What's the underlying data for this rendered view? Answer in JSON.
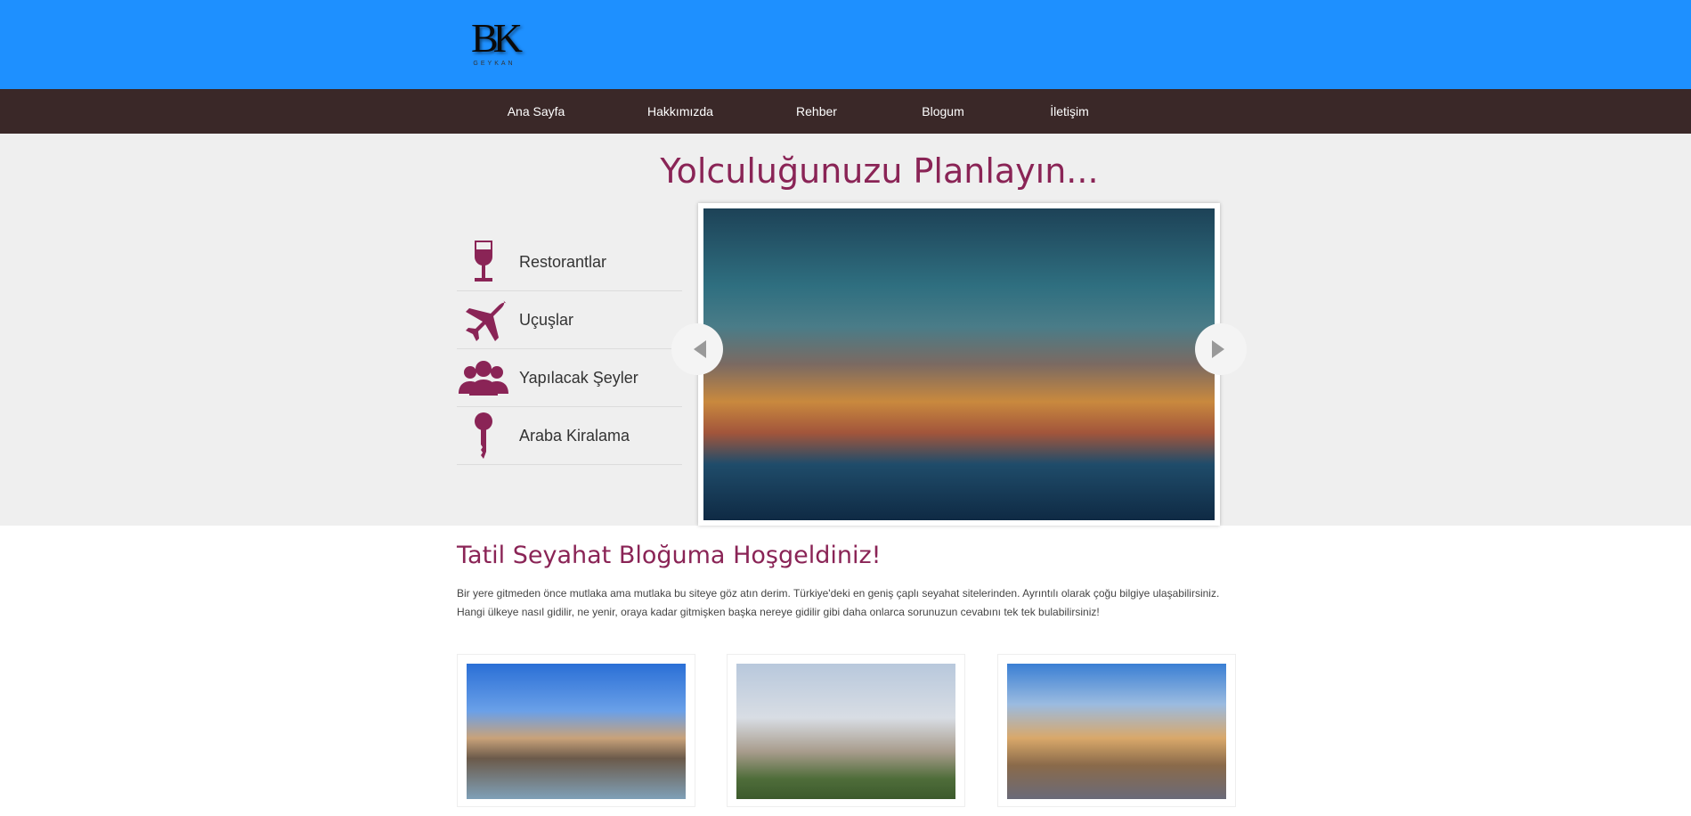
{
  "header": {
    "logo_text": "BK",
    "logo_sub": "GEYKAN",
    "bg": "#1e90ff"
  },
  "nav": {
    "items": [
      {
        "label": "Ana Sayfa"
      },
      {
        "label": "Hakkımızda"
      },
      {
        "label": "Rehber"
      },
      {
        "label": "Blogum"
      },
      {
        "label": "İletişim"
      }
    ]
  },
  "hero": {
    "title": "Yolculuğunuzu Planlayın...",
    "menu": [
      {
        "label": "Restorantlar",
        "icon": "wine-glass-icon"
      },
      {
        "label": "Uçuşlar",
        "icon": "airplane-icon"
      },
      {
        "label": "Yapılacak Şeyler",
        "icon": "people-icon"
      },
      {
        "label": "Araba Kiralama",
        "icon": "key-icon"
      }
    ],
    "accent": "#8a2456"
  },
  "main": {
    "title": "Tatil Seyahat Bloğuma Hoşgeldiniz!",
    "para1": "Bir yere gitmeden önce mutlaka ama mutlaka bu siteye göz atın derim. Türkiye'deki en geniş çaplı seyahat sitelerinden. Ayrıntılı olarak çoğu bilgiye ulaşabilirsiniz.",
    "para2": "Hangi ülkeye nasıl gidilir, ne yenir, oraya kadar gitmişken başka nereye gidilir gibi daha onlarca sorunuzun cevabını tek tek bulabilirsiniz!"
  }
}
